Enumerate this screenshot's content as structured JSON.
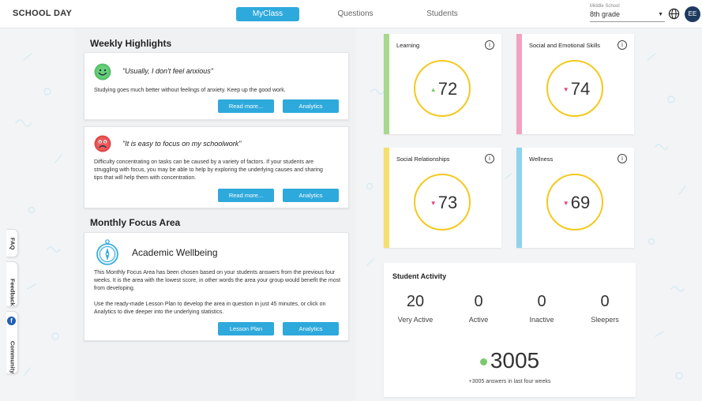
{
  "header": {
    "logo": "SCHOOL DAY",
    "tabs": [
      {
        "label": "MyClass",
        "active": true
      },
      {
        "label": "Questions",
        "active": false
      },
      {
        "label": "Students",
        "active": false
      }
    ],
    "school_label": "Middle School",
    "grade_value": "8th grade",
    "avatar_initials": "EE"
  },
  "highlights": {
    "title": "Weekly Highlights",
    "cards": [
      {
        "quote": "\"Usually, I don't feel anxious\"",
        "text": "Studying goes much better without feelings of anxiety. Keep up the good work.",
        "read_more": "Read more...",
        "analytics": "Analytics",
        "face": "happy"
      },
      {
        "quote": "\"It is easy to focus on my schoolwork\"",
        "text": "Difficulty concentrating on tasks can be caused by a variety of factors. If your students are struggling with focus, you may be able to help by exploring the underlying causes and sharing tips that will help them with concentration.",
        "read_more": "Read more...",
        "analytics": "Analytics",
        "face": "sad"
      }
    ]
  },
  "focus": {
    "title": "Monthly Focus Area",
    "heading": "Academic Wellbeing",
    "para1": "This Monthly Focus Area has been chosen based on your students answers from the previous four  weeks. It is the area with the lowest score, in other words the area your group would benefit the most from developing.",
    "para2": "Use the ready-made Lesson Plan to develop the area in question in just 45 minutes, or click on Analytics to dive deeper into the underlying statistics.",
    "lesson_plan": "Lesson Plan",
    "analytics": "Analytics"
  },
  "side_tabs": {
    "faq": "FAQ",
    "feedback": "Feedback",
    "community": "Community"
  },
  "metrics": [
    {
      "title": "Learning",
      "score": "72",
      "trend": "up",
      "color": "#a6d98d"
    },
    {
      "title": "Social and Emotional Skills",
      "score": "74",
      "trend": "down",
      "color": "#f2a2c0"
    },
    {
      "title": "Social Relationships",
      "score": "73",
      "trend": "down",
      "color": "#f7df6f"
    },
    {
      "title": "Wellness",
      "score": "69",
      "trend": "down",
      "color": "#8fd3ee"
    }
  ],
  "activity": {
    "title": "Student Activity",
    "stats": [
      {
        "value": "20",
        "label": "Very Active"
      },
      {
        "value": "0",
        "label": "Active"
      },
      {
        "value": "0",
        "label": "Inactive"
      },
      {
        "value": "0",
        "label": "Sleepers"
      }
    ],
    "total": "3005",
    "total_note": "+3005 answers in last four weeks"
  },
  "colors": {
    "accent": "#2ea9dc",
    "ring": "#f4c91e",
    "trend_up": "#7dc86e",
    "trend_down": "#e0457b",
    "avatar": "#1f3a5f"
  }
}
